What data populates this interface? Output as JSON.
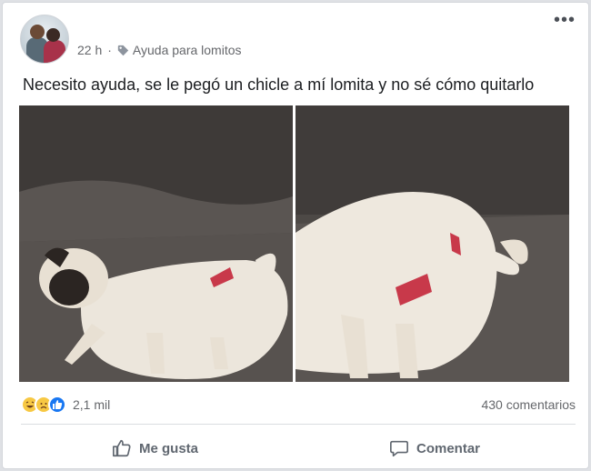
{
  "post": {
    "time": "22 h",
    "separator": "·",
    "group_tag": "Ayuda para lomitos",
    "more_label": "•••",
    "text": "Necesito ayuda, se le pegó un chicle a mí lomita y no sé cómo quitarlo"
  },
  "stats": {
    "reaction_count": "2,1 mil",
    "comments": "430 comentarios",
    "reaction_icons": [
      "haha-icon",
      "sad-icon",
      "like-icon"
    ]
  },
  "actions": {
    "like_label": "Me gusta",
    "comment_label": "Comentar"
  },
  "colors": {
    "accent": "#1877f2",
    "text_secondary": "#65676b",
    "reaction_yellow": "#f7c843"
  }
}
